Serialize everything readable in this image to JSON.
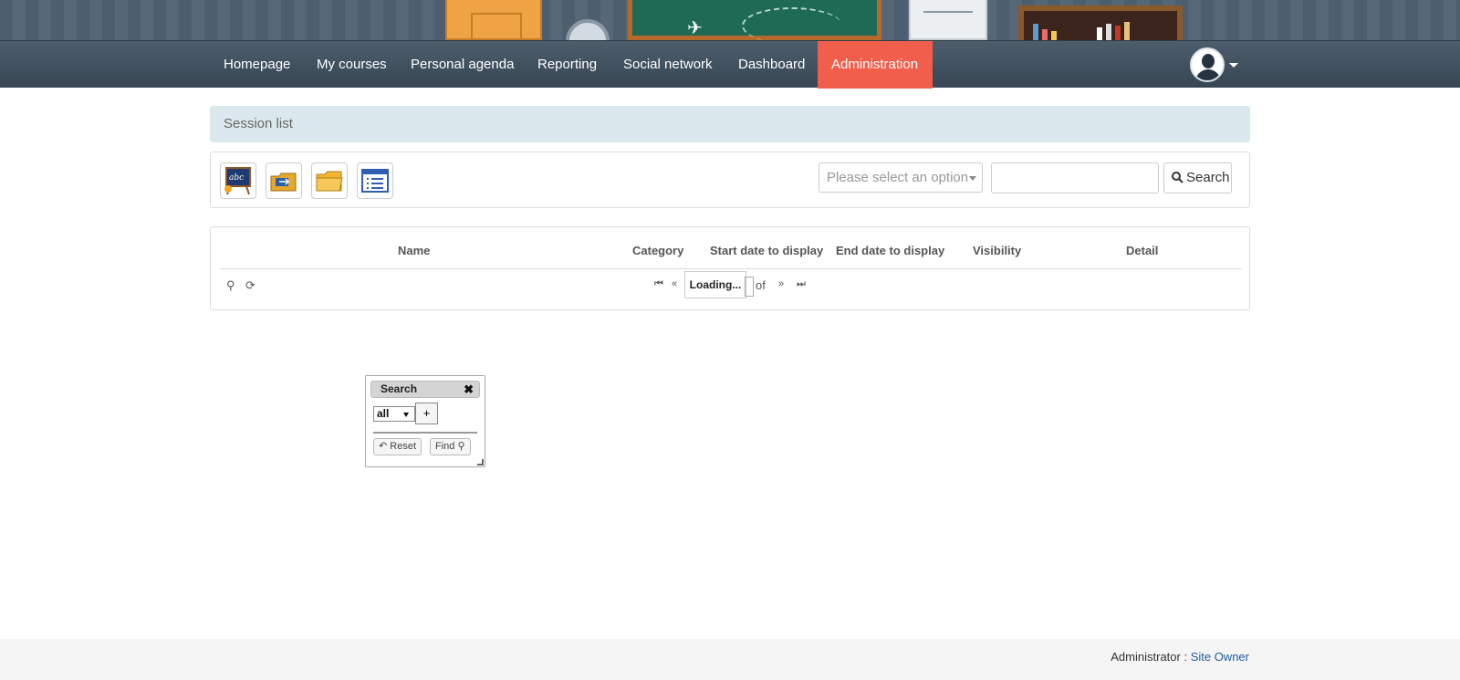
{
  "nav": {
    "items": [
      {
        "label": "Homepage"
      },
      {
        "label": "My courses"
      },
      {
        "label": "Personal agenda"
      },
      {
        "label": "Reporting"
      },
      {
        "label": "Social network"
      },
      {
        "label": "Dashboard"
      },
      {
        "label": "Administration",
        "active": true
      }
    ],
    "active_color": "#f25e4c"
  },
  "breadcrumb": {
    "current": "Session list"
  },
  "toolbar": {
    "icons": [
      "add-session-icon",
      "import-sessions-icon",
      "export-sessions-icon",
      "session-list-icon"
    ],
    "select_placeholder": "Please select an option",
    "search_label": "Search"
  },
  "grid": {
    "columns": [
      "Name",
      "Category",
      "Start date to display",
      "End date to display",
      "Visibility",
      "Detail"
    ],
    "pager": {
      "status": "Loading...",
      "of_label": "of"
    }
  },
  "search_dialog": {
    "title": "Search",
    "operator": "all",
    "add_label": "+",
    "reset_label": "Reset",
    "find_label": "Find"
  },
  "footer": {
    "role": "Administrator",
    "separator": " : ",
    "owner": "Site Owner"
  }
}
